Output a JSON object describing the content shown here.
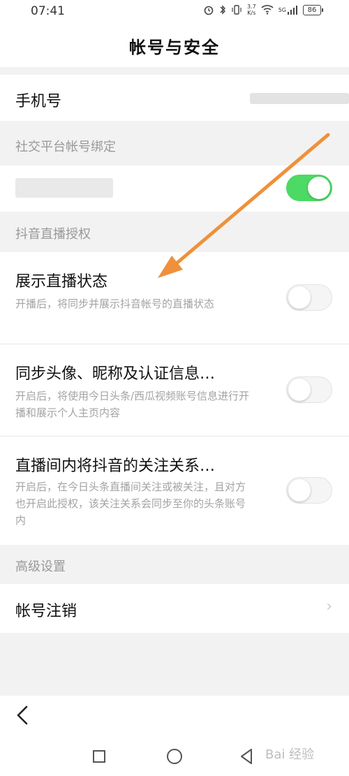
{
  "status_bar": {
    "time": "07:41",
    "net_speed_value": "3.7",
    "net_speed_unit": "K/s",
    "network": "5G",
    "battery": "86"
  },
  "header": {
    "title": "帐号与安全"
  },
  "phone_row": {
    "label": "手机号"
  },
  "section_social": {
    "label": "社交平台帐号绑定"
  },
  "douyin_row": {
    "toggle_state": "on"
  },
  "section_live": {
    "label": "抖音直播授权"
  },
  "live_items": [
    {
      "title": "展示直播状态",
      "desc": "开播后，将同步并展示抖音帐号的直播状态",
      "toggle_state": "off"
    },
    {
      "title": "同步头像、昵称及认证信息…",
      "desc": "开启后，将使用今日头条/西瓜视频账号信息进行开播和展示个人主页内容",
      "toggle_state": "off"
    },
    {
      "title": "直播间内将抖音的关注关系…",
      "desc": "开启后，在今日头条直播间关注或被关注，且对方也开启此授权，该关注关系会同步至你的头条账号内",
      "toggle_state": "off"
    }
  ],
  "section_advanced": {
    "label": "高级设置"
  },
  "cancel_row": {
    "label": "帐号注销"
  },
  "watermark": {
    "text": "Bai 经验"
  },
  "colors": {
    "toggle_on": "#4cd964",
    "annotation_arrow": "#f0903a"
  }
}
